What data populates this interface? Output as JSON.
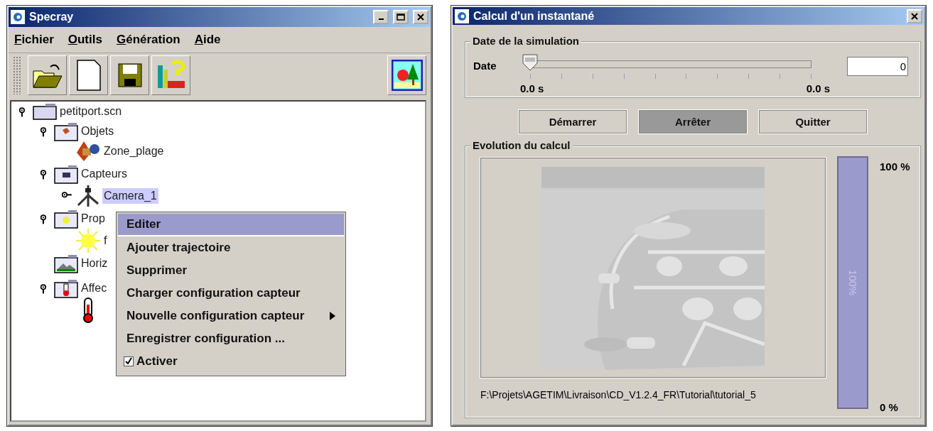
{
  "main_window": {
    "title": "Specray",
    "menus": [
      {
        "label": "Fichier"
      },
      {
        "label": "Outils"
      },
      {
        "label": "Génération"
      },
      {
        "label": "Aide"
      }
    ],
    "tree": [
      {
        "label": "petitport.scn",
        "kind": "file",
        "expanded": true,
        "selected": false,
        "children": [
          {
            "label": "Objets",
            "kind": "objects-folder",
            "expanded": true,
            "selected": false,
            "children": [
              {
                "label": "Zone_plage",
                "kind": "shape",
                "selected": false
              }
            ]
          },
          {
            "label": "Capteurs",
            "kind": "sensors-folder",
            "expanded": true,
            "selected": false,
            "children": [
              {
                "label": "Camera_1",
                "kind": "camera",
                "expanded": false,
                "selected": true
              }
            ]
          },
          {
            "label": "Prop",
            "kind": "light-folder",
            "expanded": true,
            "selected": false,
            "children": [
              {
                "label": "f",
                "kind": "sun",
                "selected": false
              }
            ]
          },
          {
            "label": "Horiz",
            "kind": "horizon-folder",
            "selected": false
          },
          {
            "label": "Affec",
            "kind": "heat-folder",
            "expanded": true,
            "selected": false,
            "children": [
              {
                "kind": "thermometer"
              }
            ]
          }
        ]
      }
    ],
    "context_menu": [
      {
        "label": "Editer",
        "kind": "item",
        "selected": true
      },
      {
        "label": "Ajouter trajectoire",
        "kind": "item",
        "selected": false
      },
      {
        "label": "Supprimer",
        "kind": "item",
        "selected": false
      },
      {
        "label": "Charger configuration capteur",
        "kind": "item",
        "selected": false
      },
      {
        "label": "Nouvelle configuration capteur",
        "kind": "submenu",
        "selected": false
      },
      {
        "label": "Enregistrer configuration ...",
        "kind": "item",
        "selected": false
      },
      {
        "label": "Activer",
        "kind": "check",
        "checked": true,
        "selected": false
      }
    ]
  },
  "dialog": {
    "title": "Calcul d'un instantané",
    "date_group": {
      "title": "Date de la simulation",
      "label": "Date",
      "level": 0,
      "min_label": "0.0 s",
      "max_label": "0.0 s",
      "value": "0"
    },
    "buttons": [
      {
        "label": "Démarrer",
        "selected": false
      },
      {
        "label": "Arrêter",
        "selected": true
      },
      {
        "label": "Quitter",
        "selected": false
      }
    ],
    "progress_group": {
      "title": "Evolution du calcul",
      "path": "F:\\Projets\\AGETIM\\Livraison\\CD_V1.2.4_FR\\Tutorial\\tutorial_5",
      "level": 1,
      "bar_text": "100%",
      "top_label": "100 %",
      "bottom_label": "0 %"
    }
  }
}
